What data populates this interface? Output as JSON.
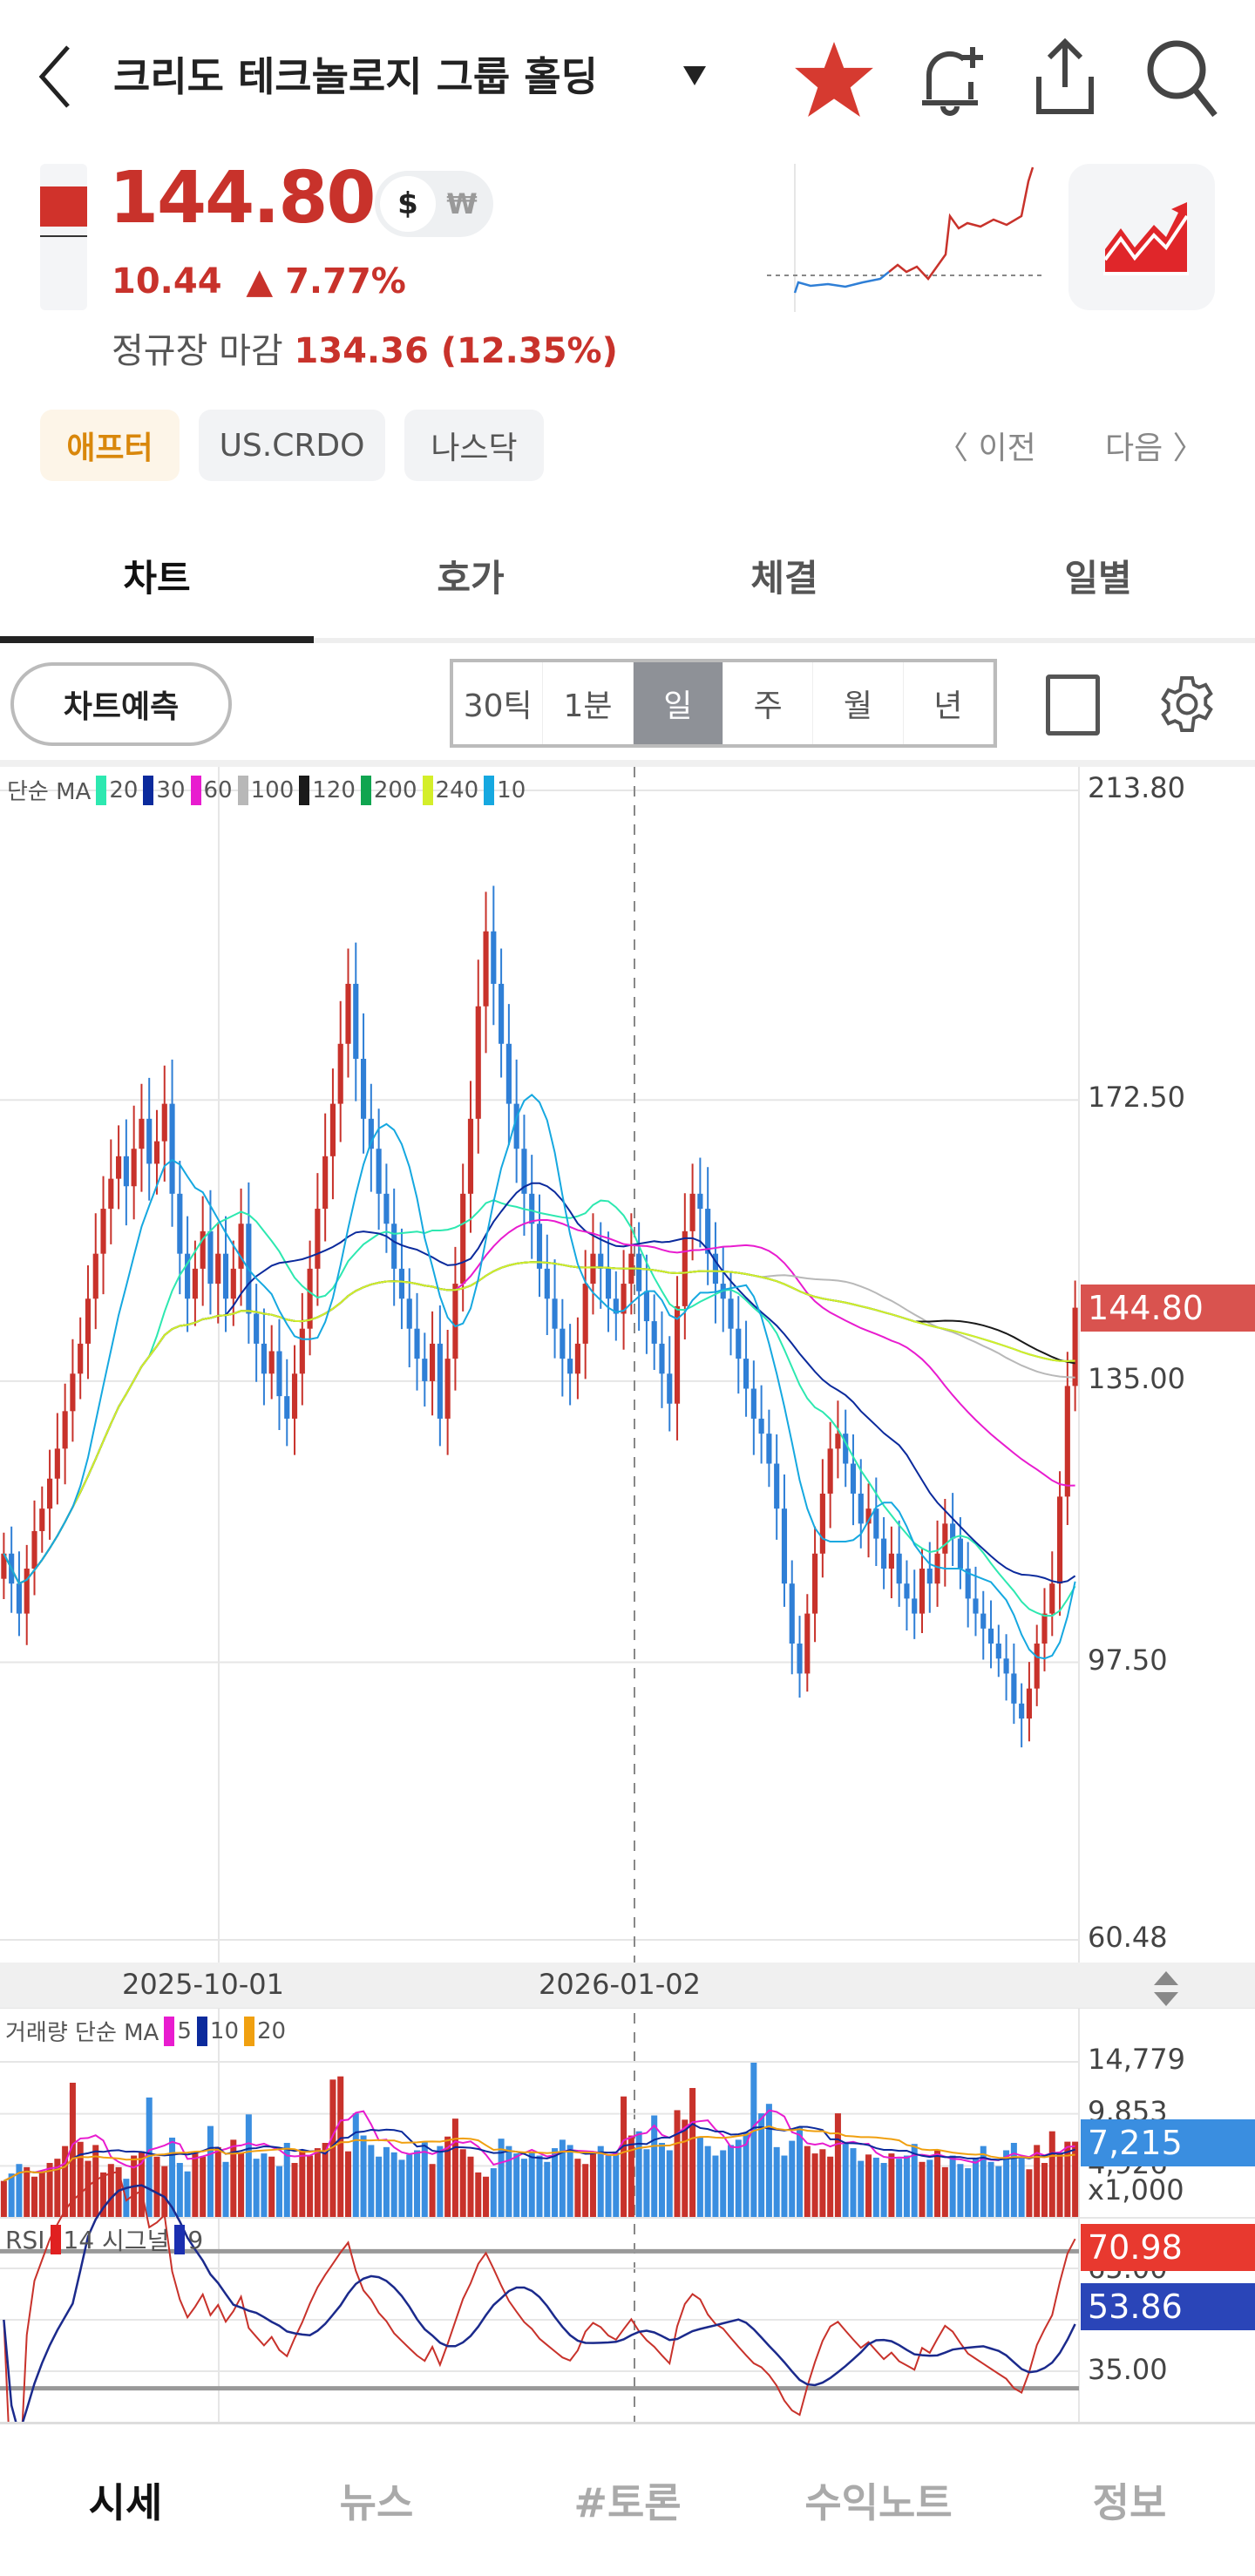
{
  "header": {
    "title": "크리도 테크놀로지 그룹 홀딩",
    "icons": [
      "back-icon",
      "dropdown-icon",
      "star-icon",
      "alarm-add-icon",
      "share-icon",
      "search-icon"
    ]
  },
  "quote": {
    "price": "144.80",
    "currency_on": "$",
    "currency_off": "₩",
    "change": "10.44",
    "change_pct": "▲ 7.77%",
    "regular_label": "정규장 마감",
    "regular_value": "134.36 (12.35%)"
  },
  "tags": [
    "애프터",
    "US.CRDO",
    "나스닥"
  ],
  "nav": {
    "prev": "〈 이전",
    "next": "다음 〉"
  },
  "tabs": [
    "차트",
    "호가",
    "체결",
    "일별"
  ],
  "toolbar": {
    "predict": "차트예측",
    "periods": [
      "30틱",
      "1분",
      "일",
      "주",
      "월",
      "년"
    ],
    "selected": "일"
  },
  "colors": {
    "up": "#c8322b",
    "down": "#2f7fd6",
    "accent_tag": "#fdf5e8"
  },
  "chart_data": {
    "type": "candlestick",
    "ma_label": "단순 MA",
    "ma": [
      {
        "p": 20,
        "color": "#2de8b0"
      },
      {
        "p": 30,
        "color": "#0b2a9c"
      },
      {
        "p": 60,
        "color": "#e81ccf"
      },
      {
        "p": 100,
        "color": "#b8b8b8"
      },
      {
        "p": 120,
        "color": "#1a1a1a"
      },
      {
        "p": 200,
        "color": "#10a550"
      },
      {
        "p": 240,
        "color": "#d4ee2a"
      },
      {
        "p": 10,
        "color": "#16a8e0"
      }
    ],
    "y_ticks": [
      "213.80",
      "172.50",
      "135.00",
      "97.50",
      "60.48"
    ],
    "y_tick_values": [
      213.8,
      172.5,
      135.0,
      97.5,
      60.48
    ],
    "ylim": [
      60.48,
      213.8
    ],
    "x_ticks": [
      "2025-10-01",
      "2026-01-02"
    ],
    "x_tick_index": [
      24,
      72
    ],
    "last_price": "144.80",
    "closes": [
      112,
      108,
      104,
      110,
      115,
      118,
      122,
      126,
      131,
      136,
      140,
      146,
      152,
      158,
      162,
      165,
      161,
      166,
      170,
      164,
      167,
      172,
      160,
      152,
      146,
      150,
      155,
      148,
      152,
      146,
      150,
      156,
      144,
      140,
      136,
      139,
      133,
      130,
      136,
      142,
      150,
      158,
      165,
      172,
      180,
      188,
      178,
      170,
      166,
      160,
      156,
      150,
      146,
      142,
      138,
      135,
      140,
      130,
      138,
      148,
      160,
      170,
      185,
      195,
      188,
      180,
      172,
      166,
      160,
      156,
      150,
      146,
      142,
      138,
      136,
      140,
      148,
      152,
      150,
      146,
      144,
      148,
      152,
      147,
      143,
      140,
      136,
      132,
      145,
      155,
      160,
      158,
      152,
      148,
      146,
      142,
      138,
      134,
      130,
      128,
      124,
      118,
      108,
      100,
      96,
      104,
      112,
      120,
      126,
      128,
      124,
      120,
      116,
      118,
      114,
      110,
      112,
      108,
      106,
      104,
      110,
      108,
      112,
      116,
      114,
      110,
      106,
      104,
      102,
      100,
      98,
      96,
      92,
      90,
      94,
      100,
      104,
      108,
      119.6,
      134.36,
      144.8
    ],
    "volume": {
      "label": "거래량 단순 MA",
      "ma": [
        {
          "p": 5,
          "color": "#e81ccf"
        },
        {
          "p": 10,
          "color": "#0b2a9c"
        },
        {
          "p": 20,
          "color": "#f0a010"
        }
      ],
      "y_ticks": [
        "14,779",
        "9,853",
        "4,926",
        "x1,000"
      ],
      "y_tick_values": [
        14779,
        9853,
        4926
      ],
      "last": "7,215",
      "values": [
        3500,
        4200,
        5100,
        4800,
        3900,
        4400,
        5200,
        5600,
        6800,
        12800,
        7200,
        5400,
        6900,
        4300,
        5100,
        4800,
        3700,
        5900,
        6300,
        11400,
        5800,
        4900,
        7600,
        5200,
        4400,
        6100,
        5800,
        8700,
        6700,
        5300,
        7400,
        6200,
        9800,
        5600,
        6100,
        5800,
        4900,
        7100,
        5200,
        6400,
        5900,
        6600,
        7100,
        13100,
        13400,
        6300,
        9900,
        7800,
        6900,
        5800,
        6700,
        6200,
        5500,
        6000,
        6400,
        7200,
        5100,
        6800,
        7700,
        9400,
        6500,
        5800,
        4300,
        3900,
        4700,
        7500,
        6800,
        6100,
        5600,
        6200,
        5900,
        5300,
        6600,
        7400,
        6900,
        5600,
        5100,
        6300,
        6800,
        5900,
        6200,
        11500,
        7800,
        8200,
        6500,
        9700,
        7100,
        6400,
        10200,
        9300,
        12300,
        7600,
        6800,
        5900,
        6400,
        6900,
        7400,
        8100,
        14700,
        9900,
        10800,
        6700,
        5900,
        7300,
        8600,
        6800,
        6100,
        6500,
        5800,
        9900,
        7200,
        6600,
        5400,
        6000,
        5700,
        5200,
        6100,
        5600,
        5900,
        7000,
        5300,
        5500,
        6400,
        4800,
        5900,
        5100,
        4700,
        5600,
        6800,
        5300,
        4900,
        6400,
        7100,
        5800,
        4600,
        6900,
        5200,
        8200,
        6100,
        7215,
        7215
      ]
    },
    "rsi": {
      "label": "RSI",
      "period": "14",
      "signal_label": "시그널",
      "signal": "9",
      "y_ticks": [
        "65.00",
        "50.00",
        "35.00"
      ],
      "y_tick_values": [
        65,
        50,
        35
      ],
      "value": "70.98",
      "signal_value": "53.86"
    }
  },
  "bottom_nav": [
    "시세",
    "뉴스",
    "#토론",
    "수익노트",
    "정보"
  ]
}
